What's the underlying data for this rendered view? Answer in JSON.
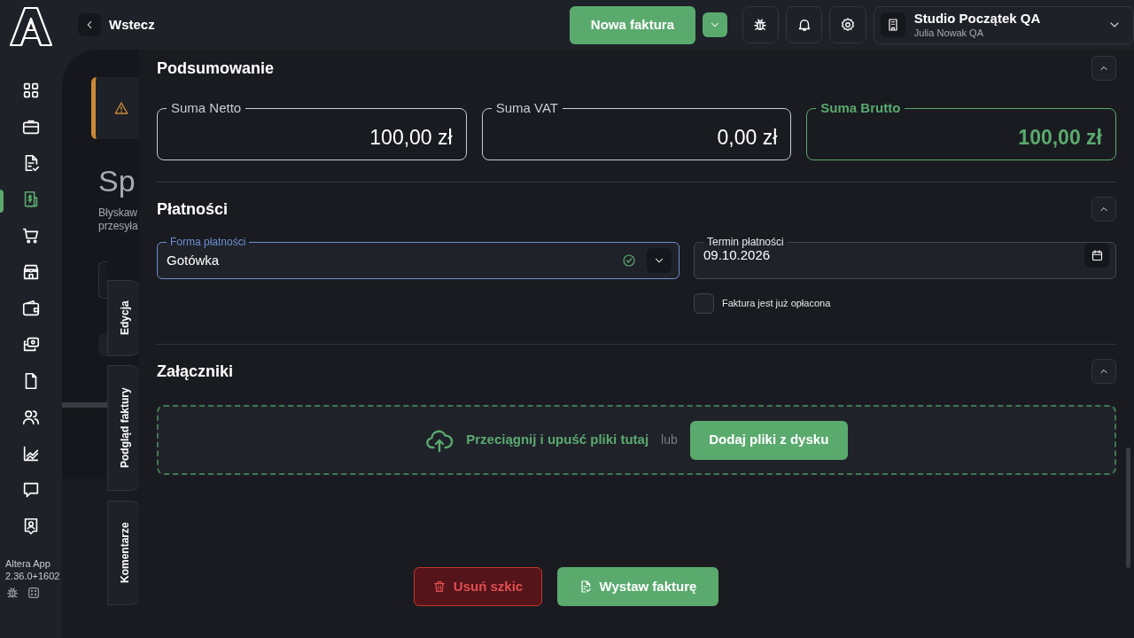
{
  "topbar": {
    "back": "Wstecz",
    "primary_button": "Nowa faktura",
    "organization": {
      "name": "Studio Początek QA",
      "user": "Julia Nowak QA"
    }
  },
  "sidebar": {
    "items": [
      {
        "selected": false
      },
      {
        "selected": false
      },
      {
        "selected": false
      },
      {
        "selected": true
      },
      {
        "selected": false
      },
      {
        "selected": false
      },
      {
        "selected": false
      },
      {
        "selected": false
      },
      {
        "selected": false
      },
      {
        "selected": false
      },
      {
        "selected": false
      },
      {
        "selected": false
      },
      {
        "selected": false
      }
    ],
    "version": [
      "Altera App",
      "2.36.0+1602"
    ]
  },
  "background_page": {
    "heading": "Sp",
    "lines": [
      "Błyskaw",
      "przesyła"
    ]
  },
  "side_tabs": [
    {
      "label": "Edycja"
    },
    {
      "label": "Podgląd faktury"
    },
    {
      "label": "Komentarze"
    }
  ],
  "summary": {
    "title": "Podsumowanie",
    "expanded": true,
    "fields": [
      {
        "label": "Suma Netto",
        "value": "100,00 zł",
        "highlighted": false
      },
      {
        "label": "Suma VAT",
        "value": "0,00 zł",
        "highlighted": false
      },
      {
        "label": "Suma Brutto",
        "value": "100,00 zł",
        "highlighted": true
      }
    ]
  },
  "payments": {
    "title": "Płatności",
    "expanded": true,
    "method": {
      "label": "Forma płatności",
      "value": "Gotówka",
      "focused": true,
      "valid": true
    },
    "due_date": {
      "label": "Termin płatności",
      "value": "09.10.2026"
    },
    "paid": {
      "label": "Faktura jest już opłacona",
      "checked": false
    }
  },
  "attachments": {
    "title": "Załączniki",
    "expanded": true,
    "drop_text": "Przeciągnij i upuść pliki tutaj",
    "or": "lub",
    "button": "Dodaj pliki z dysku"
  },
  "actions": {
    "delete": "Usuń szkic",
    "issue": "Wystaw fakturę"
  }
}
